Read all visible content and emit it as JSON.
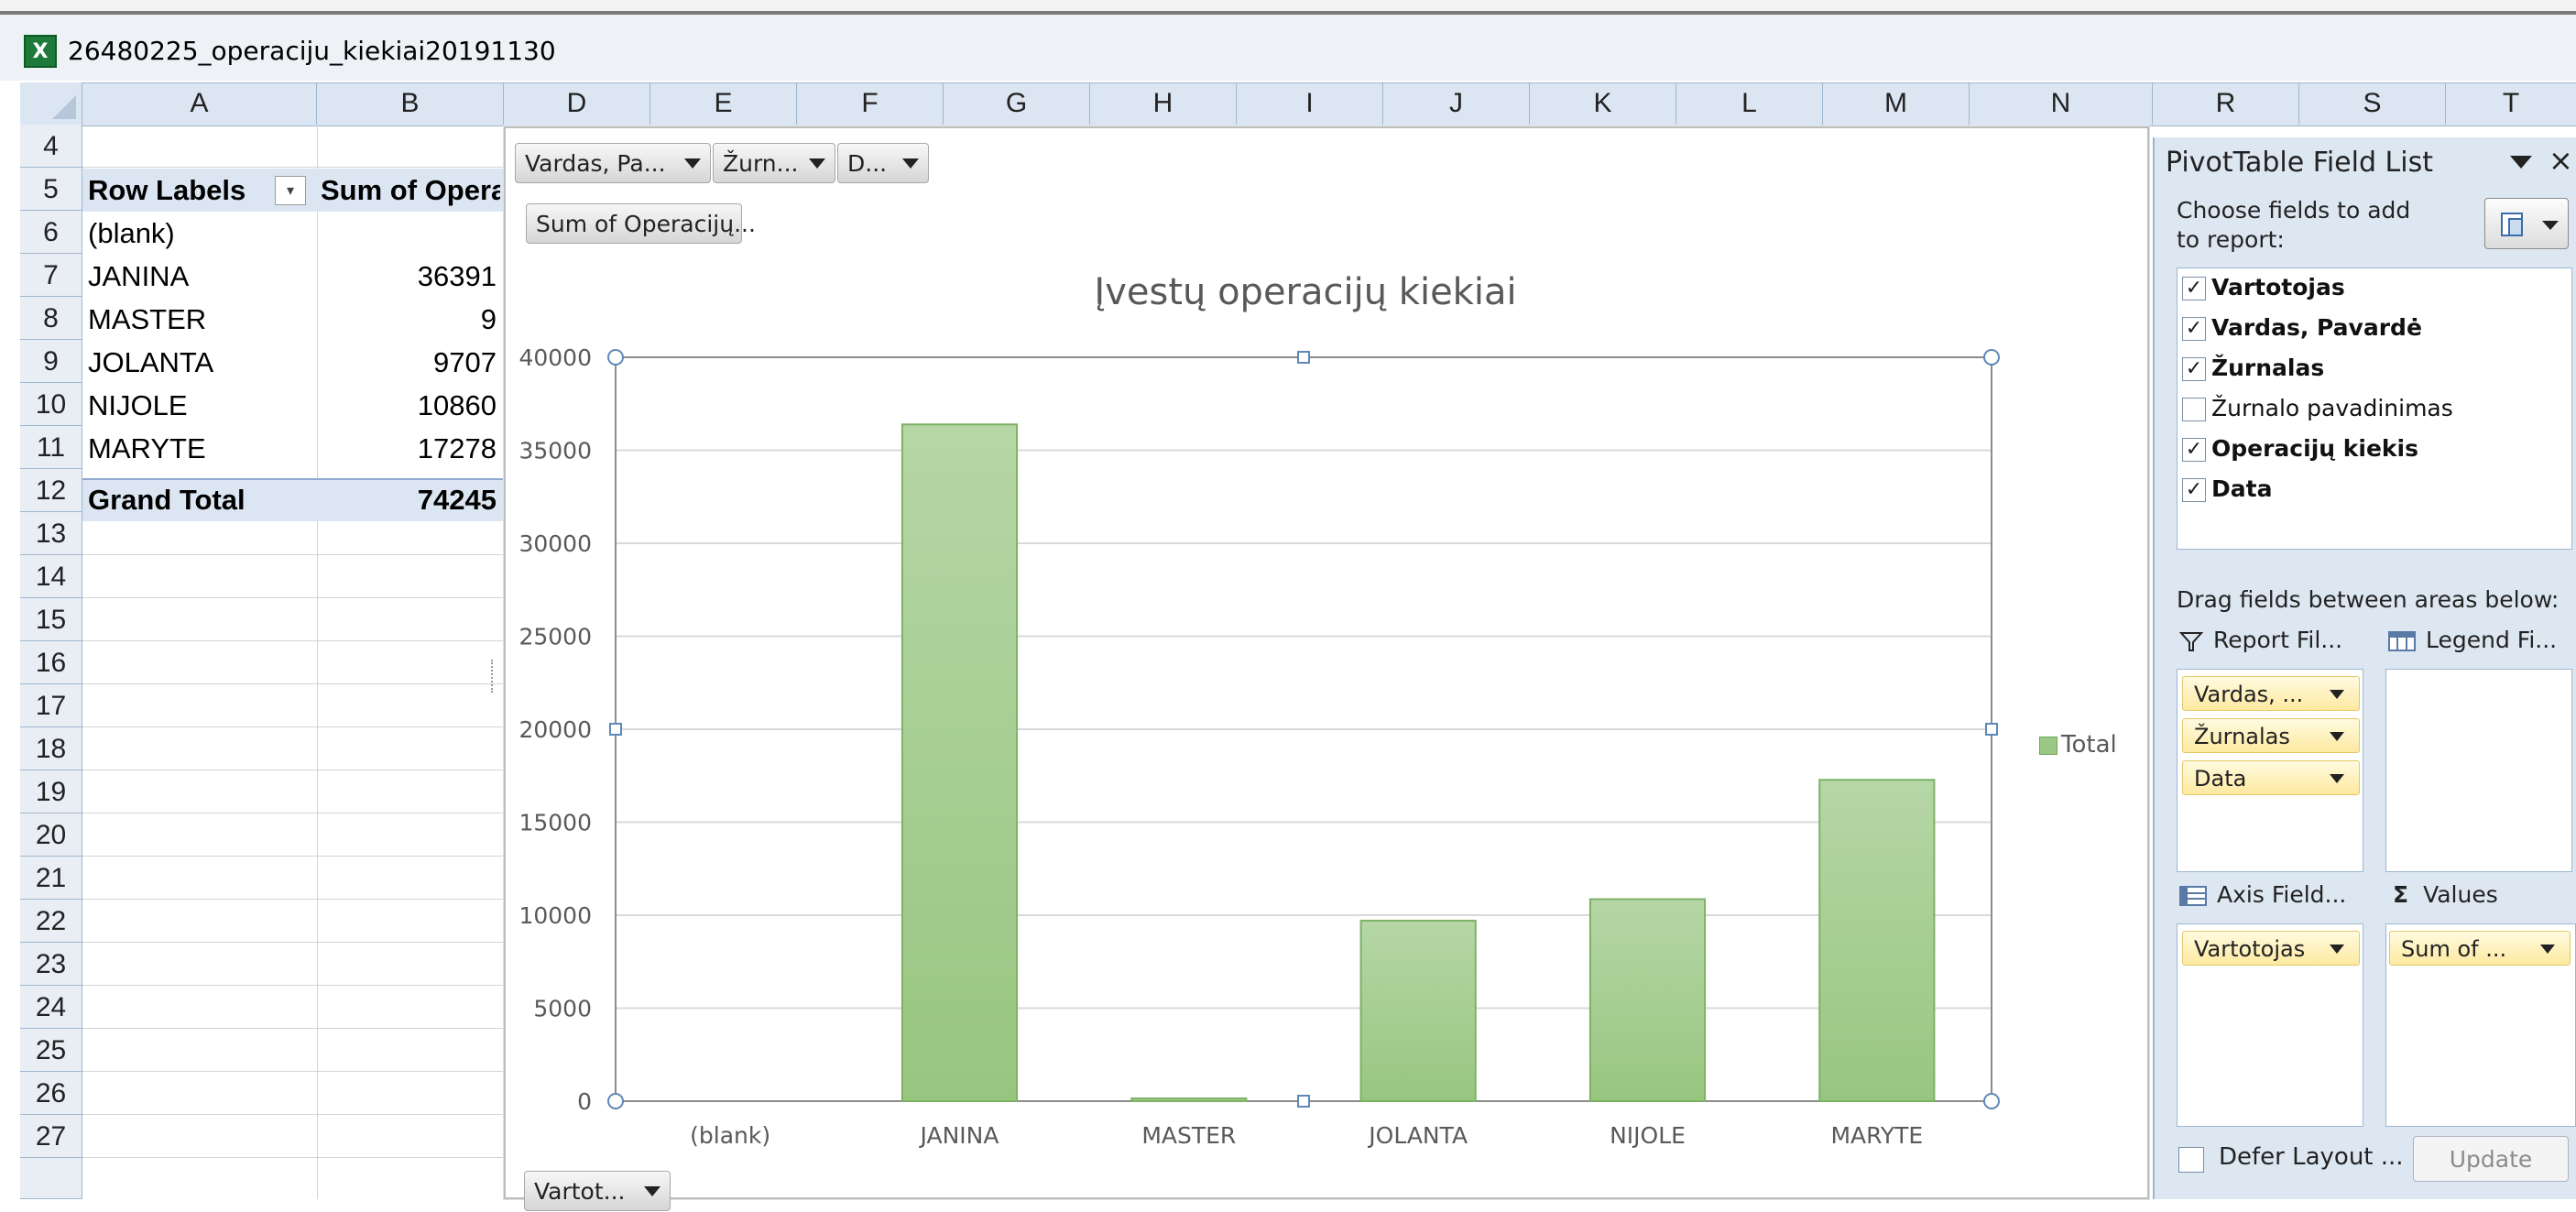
{
  "window": {
    "file_name": "26480225_operaciju_kiekiai20191130",
    "app_icon": "excel-icon",
    "app_icon_glyph": "X"
  },
  "columns": [
    "A",
    "B",
    "D",
    "E",
    "F",
    "G",
    "H",
    "I",
    "J",
    "K",
    "L",
    "M",
    "N",
    "R",
    "S",
    "T"
  ],
  "rows": [
    "4",
    "5",
    "6",
    "7",
    "8",
    "9",
    "10",
    "11",
    "12",
    "13",
    "14",
    "15",
    "16",
    "17",
    "18",
    "19",
    "20",
    "21",
    "22",
    "23",
    "24",
    "25",
    "26",
    "27"
  ],
  "pivot": {
    "header_row_labels": "Row Labels",
    "header_sum": "Sum of Opera",
    "items": [
      {
        "label": "(blank)",
        "value": ""
      },
      {
        "label": "JANINA",
        "value": "36391"
      },
      {
        "label": "MASTER",
        "value": "9"
      },
      {
        "label": "JOLANTA",
        "value": "9707"
      },
      {
        "label": "NIJOLE",
        "value": "10860"
      },
      {
        "label": "MARYTE",
        "value": "17278"
      }
    ],
    "grand_total_label": "Grand Total",
    "grand_total_value": "74245"
  },
  "chart_buttons": {
    "filter1": "Vardas, Pa...",
    "filter2": "Žurn...",
    "filter3": "D...",
    "values": "Sum of Operacijų...",
    "axis": "Vartot..."
  },
  "chart_data": {
    "type": "bar",
    "title": "Įvestų operacijų kiekiai",
    "categories": [
      "(blank)",
      "JANINA",
      "MASTER",
      "JOLANTA",
      "NIJOLE",
      "MARYTE"
    ],
    "series": [
      {
        "name": "Total",
        "values": [
          0,
          36391,
          9,
          9707,
          10860,
          17278
        ],
        "color": "#9bc985"
      }
    ],
    "ylim": [
      0,
      40000
    ],
    "yticks": [
      "0",
      "5000",
      "10000",
      "15000",
      "20000",
      "25000",
      "30000",
      "35000",
      "40000"
    ],
    "grid": true,
    "legend": "right"
  },
  "field_list": {
    "title": "PivotTable Field List",
    "choose_label": "Choose fields to add to report:",
    "fields": [
      {
        "name": "Vartotojas",
        "checked": true
      },
      {
        "name": "Vardas, Pavardė",
        "checked": true
      },
      {
        "name": "Žurnalas",
        "checked": true
      },
      {
        "name": "Žurnalo pavadinimas",
        "checked": false
      },
      {
        "name": "Operacijų kiekis",
        "checked": true
      },
      {
        "name": "Data",
        "checked": true
      }
    ],
    "drag_label": "Drag fields between areas below:",
    "report_filter_label": "Report Fil...",
    "legend_fields_label": "Legend Fi...",
    "axis_fields_label": "Axis Field...",
    "values_label": "Values",
    "report_filter_items": [
      "Vardas, ...",
      "Žurnalas",
      "Data"
    ],
    "axis_items": [
      "Vartotojas"
    ],
    "values_items": [
      "Sum of ..."
    ],
    "defer_label": "Defer Layout ...",
    "update_label": "Update",
    "check_glyph": "✓",
    "sigma_glyph": "Σ"
  }
}
